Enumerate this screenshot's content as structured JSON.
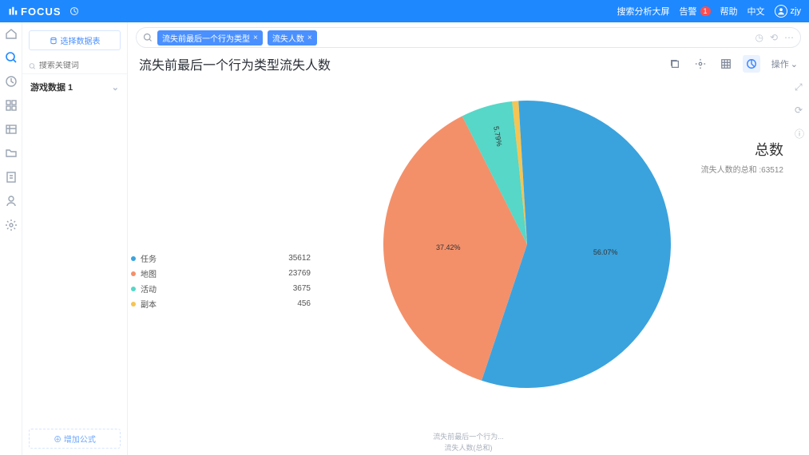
{
  "brand": "FOCUS",
  "topbar": {
    "search_analysis": "搜索分析大屏",
    "alert": "告警",
    "alert_count": "1",
    "help": "帮助",
    "lang": "中文",
    "user": "zjy"
  },
  "sidepanel": {
    "select_ds": "选择数据表",
    "search_placeholder": "搜索关键词",
    "ds_name": "游戏数据 1",
    "add_formula": "增加公式"
  },
  "search": {
    "chip1": "流失前最后一个行为类型",
    "chip2": "流失人数"
  },
  "title": "流失前最后一个行为类型流失人数",
  "actions": {
    "operate": "操作"
  },
  "total": {
    "label": "总数",
    "detail": "流失人数的总和 :63512"
  },
  "footer": {
    "line1": "流失前最后一个行为...",
    "line2": "流失人数(总和)"
  },
  "chart_data": {
    "type": "pie",
    "title": "流失前最后一个行为类型流失人数",
    "series": [
      {
        "name": "任务",
        "value": 35612,
        "pct": "56.07%",
        "color": "#3aa3dd"
      },
      {
        "name": "地图",
        "value": 23769,
        "pct": "37.42%",
        "color": "#f3906a"
      },
      {
        "name": "活动",
        "value": 3675,
        "pct": "5.79%",
        "color": "#56d7c8"
      },
      {
        "name": "副本",
        "value": 456,
        "pct": "",
        "color": "#f6c453"
      }
    ],
    "total": 63512
  }
}
